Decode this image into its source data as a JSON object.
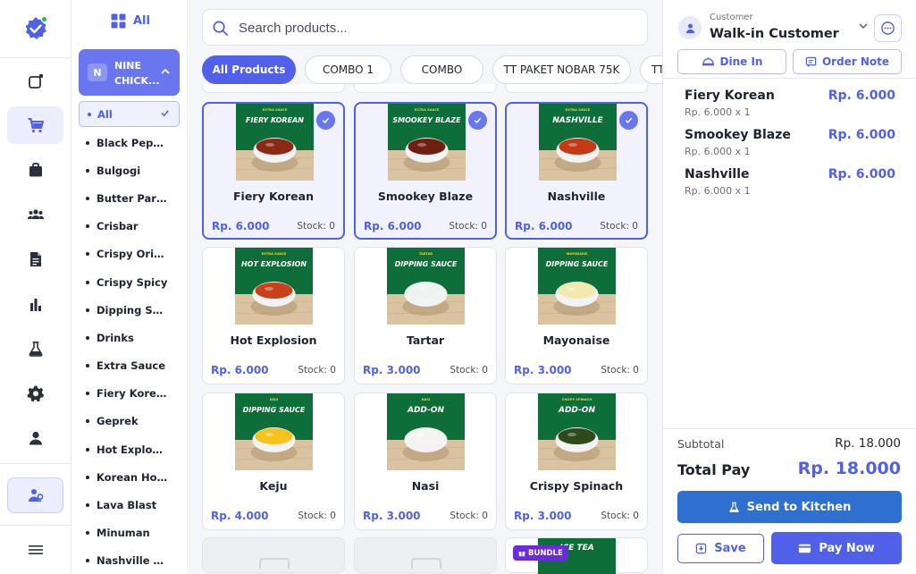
{
  "colors": {
    "accent": "#5160e8",
    "kitchen_button": "#2e6fcf",
    "selected_card": "#f1f2fd",
    "bundle_badge": "#6a2bd9",
    "product_bg": "#0e6e3a"
  },
  "rail": {
    "items": [
      {
        "icon": "new-window-icon"
      },
      {
        "icon": "cart-icon",
        "active": true
      },
      {
        "icon": "bag-icon"
      },
      {
        "icon": "users-icon"
      },
      {
        "icon": "document-icon"
      },
      {
        "icon": "bar-chart-icon"
      },
      {
        "icon": "flask-icon"
      },
      {
        "icon": "gear-icon"
      },
      {
        "icon": "person-icon"
      },
      {
        "icon": "staff-icon",
        "active": true
      },
      {
        "icon": "menu-icon"
      }
    ]
  },
  "categories": {
    "top_label": "All",
    "brand_initial": "N",
    "brand_name_line1": "NINE",
    "brand_name_line2": "CHICK...",
    "selected": "All",
    "items": [
      "Black Pepper",
      "Bulgogi",
      "Butter Parm...",
      "Crisbar",
      "Crispy Origi...",
      "Crispy Spicy",
      "Dipping Sau...",
      "Drinks",
      "Extra Sauce",
      "Fiery Korean",
      "Geprek",
      "Hot Explosion",
      "Korean Honey",
      "Lava Blast",
      "Minuman",
      "Nashville Del..."
    ]
  },
  "search": {
    "placeholder": "Search products..."
  },
  "tabs": [
    "All Products",
    "COMBO 1",
    "COMBO",
    "TT PAKET NOBAR 75K",
    "TT P"
  ],
  "products": [
    {
      "name": "Fiery Korean",
      "price": "Rp. 6.000",
      "stock": "Stock: 0",
      "selected": true,
      "banner": "FIERY KOREAN",
      "banner_small": "EXTRA SAUCE",
      "food": "#8a2a14"
    },
    {
      "name": "Smookey Blaze",
      "price": "Rp. 6.000",
      "stock": "Stock: 0",
      "selected": true,
      "banner": "SMOOKEY BLAZE",
      "banner_small": "EXTRA SAUCE",
      "food": "#6e1f10"
    },
    {
      "name": "Nashville",
      "price": "Rp. 6.000",
      "stock": "Stock: 0",
      "selected": true,
      "banner": "NASHVILLE",
      "banner_small": "EXTRA SAUCE",
      "food": "#c23a18"
    },
    {
      "name": "Hot Explosion",
      "price": "Rp. 6.000",
      "stock": "Stock: 0",
      "selected": false,
      "banner": "HOT EXPLOSION",
      "banner_small": "EXTRA SAUCE",
      "food": "#c8401c"
    },
    {
      "name": "Tartar",
      "price": "Rp. 3.000",
      "stock": "Stock: 0",
      "selected": false,
      "banner": "DIPPING SAUCE",
      "banner_small": "TARTAR",
      "food": "#eef2f0"
    },
    {
      "name": "Mayonaise",
      "price": "Rp. 3.000",
      "stock": "Stock: 0",
      "selected": false,
      "banner": "DIPPING SAUCE",
      "banner_small": "MAYONAISE",
      "food": "#f3e9b0"
    },
    {
      "name": "Keju",
      "price": "Rp. 4.000",
      "stock": "Stock: 0",
      "selected": false,
      "banner": "DIPPING SAUCE",
      "banner_small": "KEJU",
      "food": "#f6c21c"
    },
    {
      "name": "Nasi",
      "price": "Rp. 3.000",
      "stock": "Stock: 0",
      "selected": false,
      "banner": "ADD-ON",
      "banner_small": "NASI",
      "food": "#f4f4f2"
    },
    {
      "name": "Crispy Spinach",
      "price": "Rp. 3.000",
      "stock": "Stock: 0",
      "selected": false,
      "banner": "ADD-ON",
      "banner_small": "CRISPY SPINACH",
      "food": "#2f4a1a"
    }
  ],
  "bundle_badge": "BUNDLE",
  "bundle_banner": "ICE TEA",
  "customer": {
    "label": "Customer",
    "name": "Walk-in Customer"
  },
  "order_type": {
    "dine_in": "Dine In",
    "order_note": "Order Note"
  },
  "order_items": [
    {
      "name": "Fiery Korean",
      "price": "Rp. 6.000",
      "detail": "Rp. 6.000  x 1"
    },
    {
      "name": "Smookey Blaze",
      "price": "Rp. 6.000",
      "detail": "Rp. 6.000  x 1"
    },
    {
      "name": "Nashville",
      "price": "Rp. 6.000",
      "detail": "Rp. 6.000  x 1"
    }
  ],
  "summary": {
    "subtotal_label": "Subtotal",
    "subtotal_value": "Rp. 18.000",
    "total_label": "Total Pay",
    "total_value": "Rp. 18.000"
  },
  "actions": {
    "send_to_kitchen": "Send to Kitchen",
    "save": "Save",
    "pay_now": "Pay Now"
  }
}
